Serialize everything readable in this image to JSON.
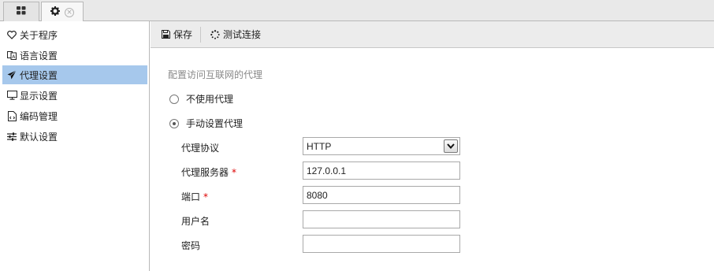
{
  "tabs": [
    {
      "icon": "grid-icon"
    },
    {
      "icon": "gear-icon",
      "close_icon": "close-icon"
    }
  ],
  "sidebar": {
    "items": [
      {
        "label": "关于程序",
        "icon": "heart-icon"
      },
      {
        "label": "语言设置",
        "icon": "language-icon"
      },
      {
        "label": "代理设置",
        "icon": "paper-plane-icon",
        "active": true
      },
      {
        "label": "显示设置",
        "icon": "monitor-icon"
      },
      {
        "label": "编码管理",
        "icon": "document-code-icon"
      },
      {
        "label": "默认设置",
        "icon": "sliders-icon"
      }
    ]
  },
  "toolbar": {
    "save_label": "保存",
    "test_label": "测试连接"
  },
  "form": {
    "section_title": "配置访问互联网的代理",
    "no_proxy_label": "不使用代理",
    "manual_proxy_label": "手动设置代理",
    "selected_option": "manual",
    "protocol_label": "代理协议",
    "protocol_value": "HTTP",
    "server_label": "代理服务器",
    "server_value": "127.0.0.1",
    "port_label": "端口",
    "port_value": "8080",
    "username_label": "用户名",
    "username_value": "",
    "password_label": "密码",
    "password_value": "",
    "required_mark": "*"
  },
  "colors": {
    "active_item_bg": "#a6c8ec",
    "required": "#dd0000",
    "toolbar_bg": "#ececec"
  }
}
